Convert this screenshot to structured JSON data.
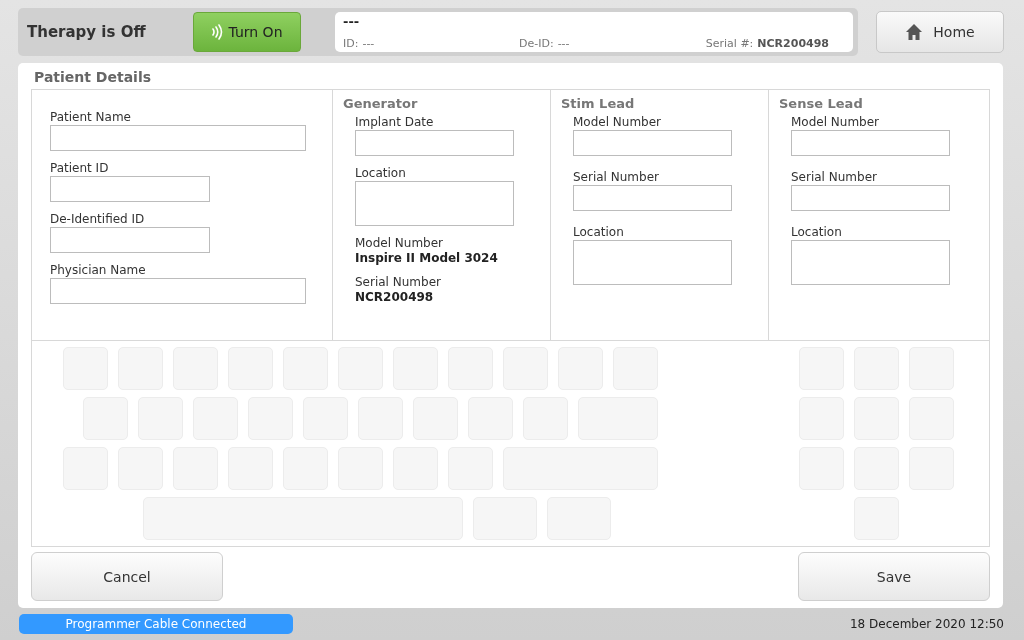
{
  "header": {
    "therapy_status": "Therapy is Off",
    "turn_on_button": "Turn On",
    "summary": {
      "name": "---",
      "id_label": "ID:",
      "id_value": "---",
      "deid_label": "De-ID:",
      "deid_value": "---",
      "serial_label": "Serial #:",
      "serial_value": "NCR200498"
    },
    "home_button": "Home"
  },
  "panel": {
    "title": "Patient Details",
    "patient_fields": [
      {
        "label": "Patient Name",
        "kind": "wide"
      },
      {
        "label": "Patient ID",
        "kind": "narrow"
      },
      {
        "label": "De-Identified ID",
        "kind": "narrow"
      },
      {
        "label": "Physician Name",
        "kind": "wide"
      }
    ],
    "sections": [
      {
        "title": "Generator",
        "items": [
          {
            "kind": "field",
            "label": "Implant Date"
          },
          {
            "kind": "tall",
            "label": "Location"
          },
          {
            "kind": "info",
            "label": "Model Number",
            "value": "Inspire II Model 3024"
          },
          {
            "kind": "info",
            "label": "Serial Number",
            "value": "NCR200498"
          }
        ]
      },
      {
        "title": "Stim Lead",
        "items": [
          {
            "kind": "field",
            "label": "Model Number"
          },
          {
            "kind": "field",
            "label": "Serial Number"
          },
          {
            "kind": "tall",
            "label": "Location"
          }
        ]
      },
      {
        "title": "Sense Lead",
        "items": [
          {
            "kind": "field",
            "label": "Model Number"
          },
          {
            "kind": "field",
            "label": "Serial Number"
          },
          {
            "kind": "tall",
            "label": "Location"
          }
        ]
      }
    ],
    "cancel_button": "Cancel",
    "save_button": "Save"
  },
  "status_bar": {
    "connection": "Programmer Cable Connected",
    "datetime": "18 December 2020 12:50"
  }
}
